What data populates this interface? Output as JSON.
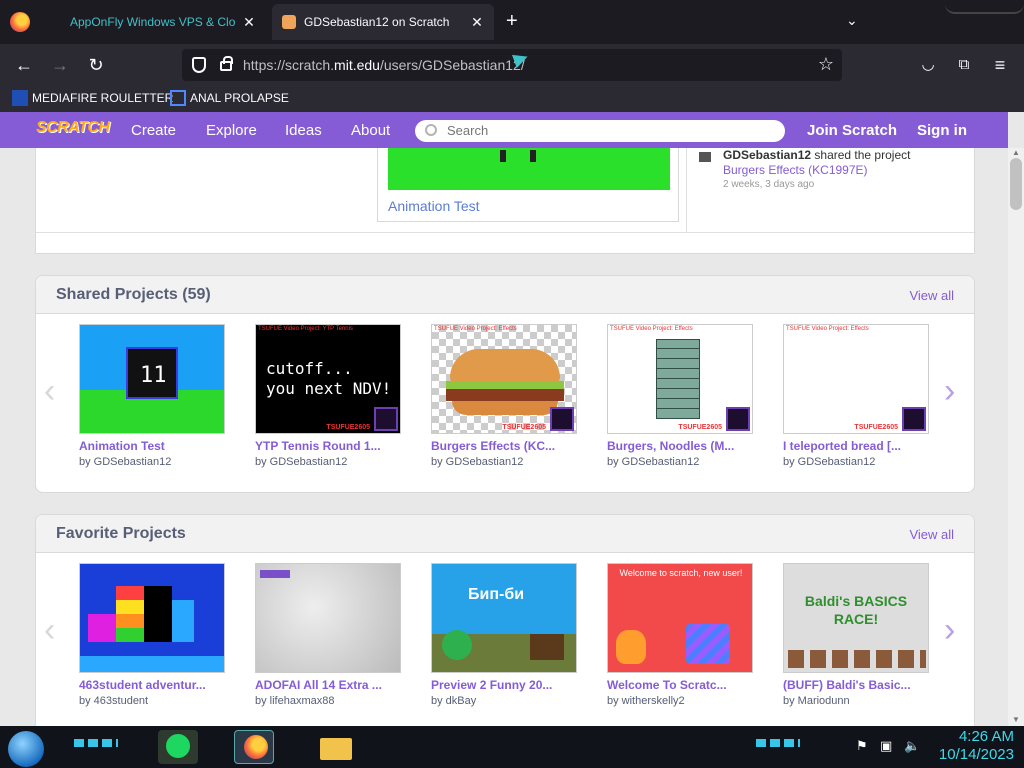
{
  "browser": {
    "tabs": [
      {
        "label": "AppOnFly Windows VPS & Clo"
      },
      {
        "label": "GDSebastian12 on Scratch"
      }
    ],
    "url_prefix": "https://scratch.",
    "url_host": "mit.edu",
    "url_path": "/users/GDSebastian12/",
    "bookmarks": [
      {
        "label": "MEDIAFIRE ROULETTER"
      },
      {
        "label": "ANAL PROLAPSE"
      }
    ]
  },
  "scratch_header": {
    "logo": "SCRATCH",
    "nav": [
      "Create",
      "Explore",
      "Ideas",
      "About"
    ],
    "search_placeholder": "Search",
    "join": "Join Scratch",
    "signin": "Sign in"
  },
  "featured": {
    "title": "Animation Test"
  },
  "activity": {
    "user": "GDSebastian12",
    "action": "shared the project",
    "project": "Burgers Effects (KC1997E)",
    "time": "2 weeks, 3 days ago"
  },
  "shared": {
    "title": "Shared Projects (59)",
    "view_all": "View all",
    "projects": [
      {
        "title": "Animation Test",
        "by": "by GDSebastian12"
      },
      {
        "title": "YTP Tennis Round 1...",
        "by": "by GDSebastian12",
        "caption": "TSUFUE Video Project: YTP Tennis",
        "big": "cutoff...\nyou next NDV!",
        "stamp": "TSUFUE2605"
      },
      {
        "title": "Burgers Effects (KC...",
        "by": "by GDSebastian12",
        "caption": "TSUFUE Video Project: Effects",
        "stamp": "TSUFUE2605"
      },
      {
        "title": "Burgers, Noodles (M...",
        "by": "by GDSebastian12",
        "caption": "TSUFUE Video Project: Effects",
        "stamp": "TSUFUE2605"
      },
      {
        "title": "I teleported bread [...",
        "by": "by GDSebastian12",
        "caption": "TSUFUE Video Project: Effects",
        "stamp": "TSUFUE2605"
      }
    ]
  },
  "favorites": {
    "title": "Favorite Projects",
    "view_all": "View all",
    "projects": [
      {
        "title": "463student adventur...",
        "by": "by 463student"
      },
      {
        "title": "ADOFAI All 14 Extra ...",
        "by": "by lifehaxmax88"
      },
      {
        "title": "Preview 2 Funny 20...",
        "by": "by dkBay",
        "banner": "Бип-би"
      },
      {
        "title": "Welcome To Scratc...",
        "by": "by witherskelly2",
        "banner": "Welcome to scratch, new user!"
      },
      {
        "title": "(BUFF) Baldi's Basic...",
        "by": "by Mariodunn",
        "banner": "Baldi's BASICS RACE!"
      }
    ]
  },
  "taskbar": {
    "time": "4:26 AM",
    "date": "10/14/2023"
  }
}
